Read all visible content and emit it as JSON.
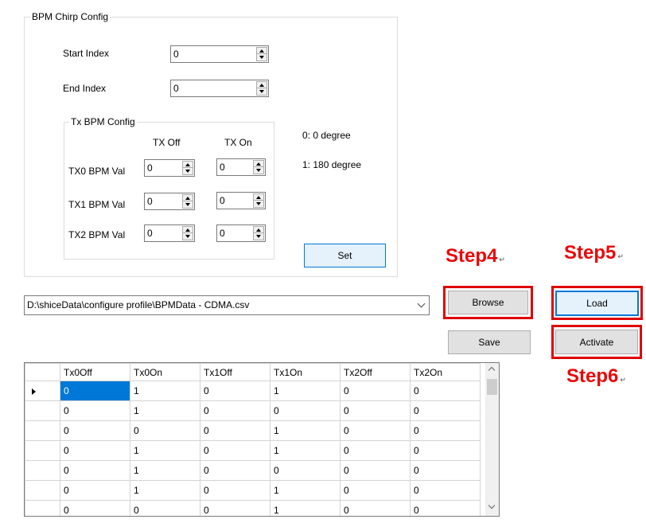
{
  "bpm_chirp_config": {
    "title": "BPM Chirp Config",
    "start_index_label": "Start Index",
    "start_index_value": "0",
    "end_index_label": "End Index",
    "end_index_value": "0"
  },
  "tx_bpm_config": {
    "title": "Tx BPM Config",
    "col_off": "TX Off",
    "col_on": "TX On",
    "rows": [
      {
        "label": "TX0 BPM Val",
        "off": "0",
        "on": "0"
      },
      {
        "label": "TX1 BPM Val",
        "off": "0",
        "on": "0"
      },
      {
        "label": "TX2 BPM Val",
        "off": "0",
        "on": "0"
      }
    ]
  },
  "legend": {
    "line1": "0: 0 degree",
    "line2": "1: 180 degree"
  },
  "buttons": {
    "set": "Set",
    "browse": "Browse",
    "load": "Load",
    "save": "Save",
    "activate": "Activate"
  },
  "file_path": "D:\\shiceData\\configure profile\\BPMData - CDMA.csv",
  "steps": {
    "step4": "Step4",
    "step5": "Step5",
    "step6": "Step6",
    "mark": "↵"
  },
  "colors": {
    "step_red": "#e8090a",
    "selection_blue": "#0078d7",
    "focus_blue": "#0078d7"
  },
  "table": {
    "headers": [
      "Tx0Off",
      "Tx0On",
      "Tx1Off",
      "Tx1On",
      "Tx2Off",
      "Tx2On"
    ],
    "rows": [
      [
        "0",
        "1",
        "0",
        "1",
        "0",
        "0"
      ],
      [
        "0",
        "1",
        "0",
        "0",
        "0",
        "0"
      ],
      [
        "0",
        "0",
        "0",
        "1",
        "0",
        "0"
      ],
      [
        "0",
        "1",
        "0",
        "1",
        "0",
        "0"
      ],
      [
        "0",
        "1",
        "0",
        "0",
        "0",
        "0"
      ],
      [
        "0",
        "1",
        "0",
        "1",
        "0",
        "0"
      ],
      [
        "0",
        "0",
        "0",
        "1",
        "0",
        "0"
      ]
    ],
    "selected_row": 0,
    "selected_col": 0
  }
}
